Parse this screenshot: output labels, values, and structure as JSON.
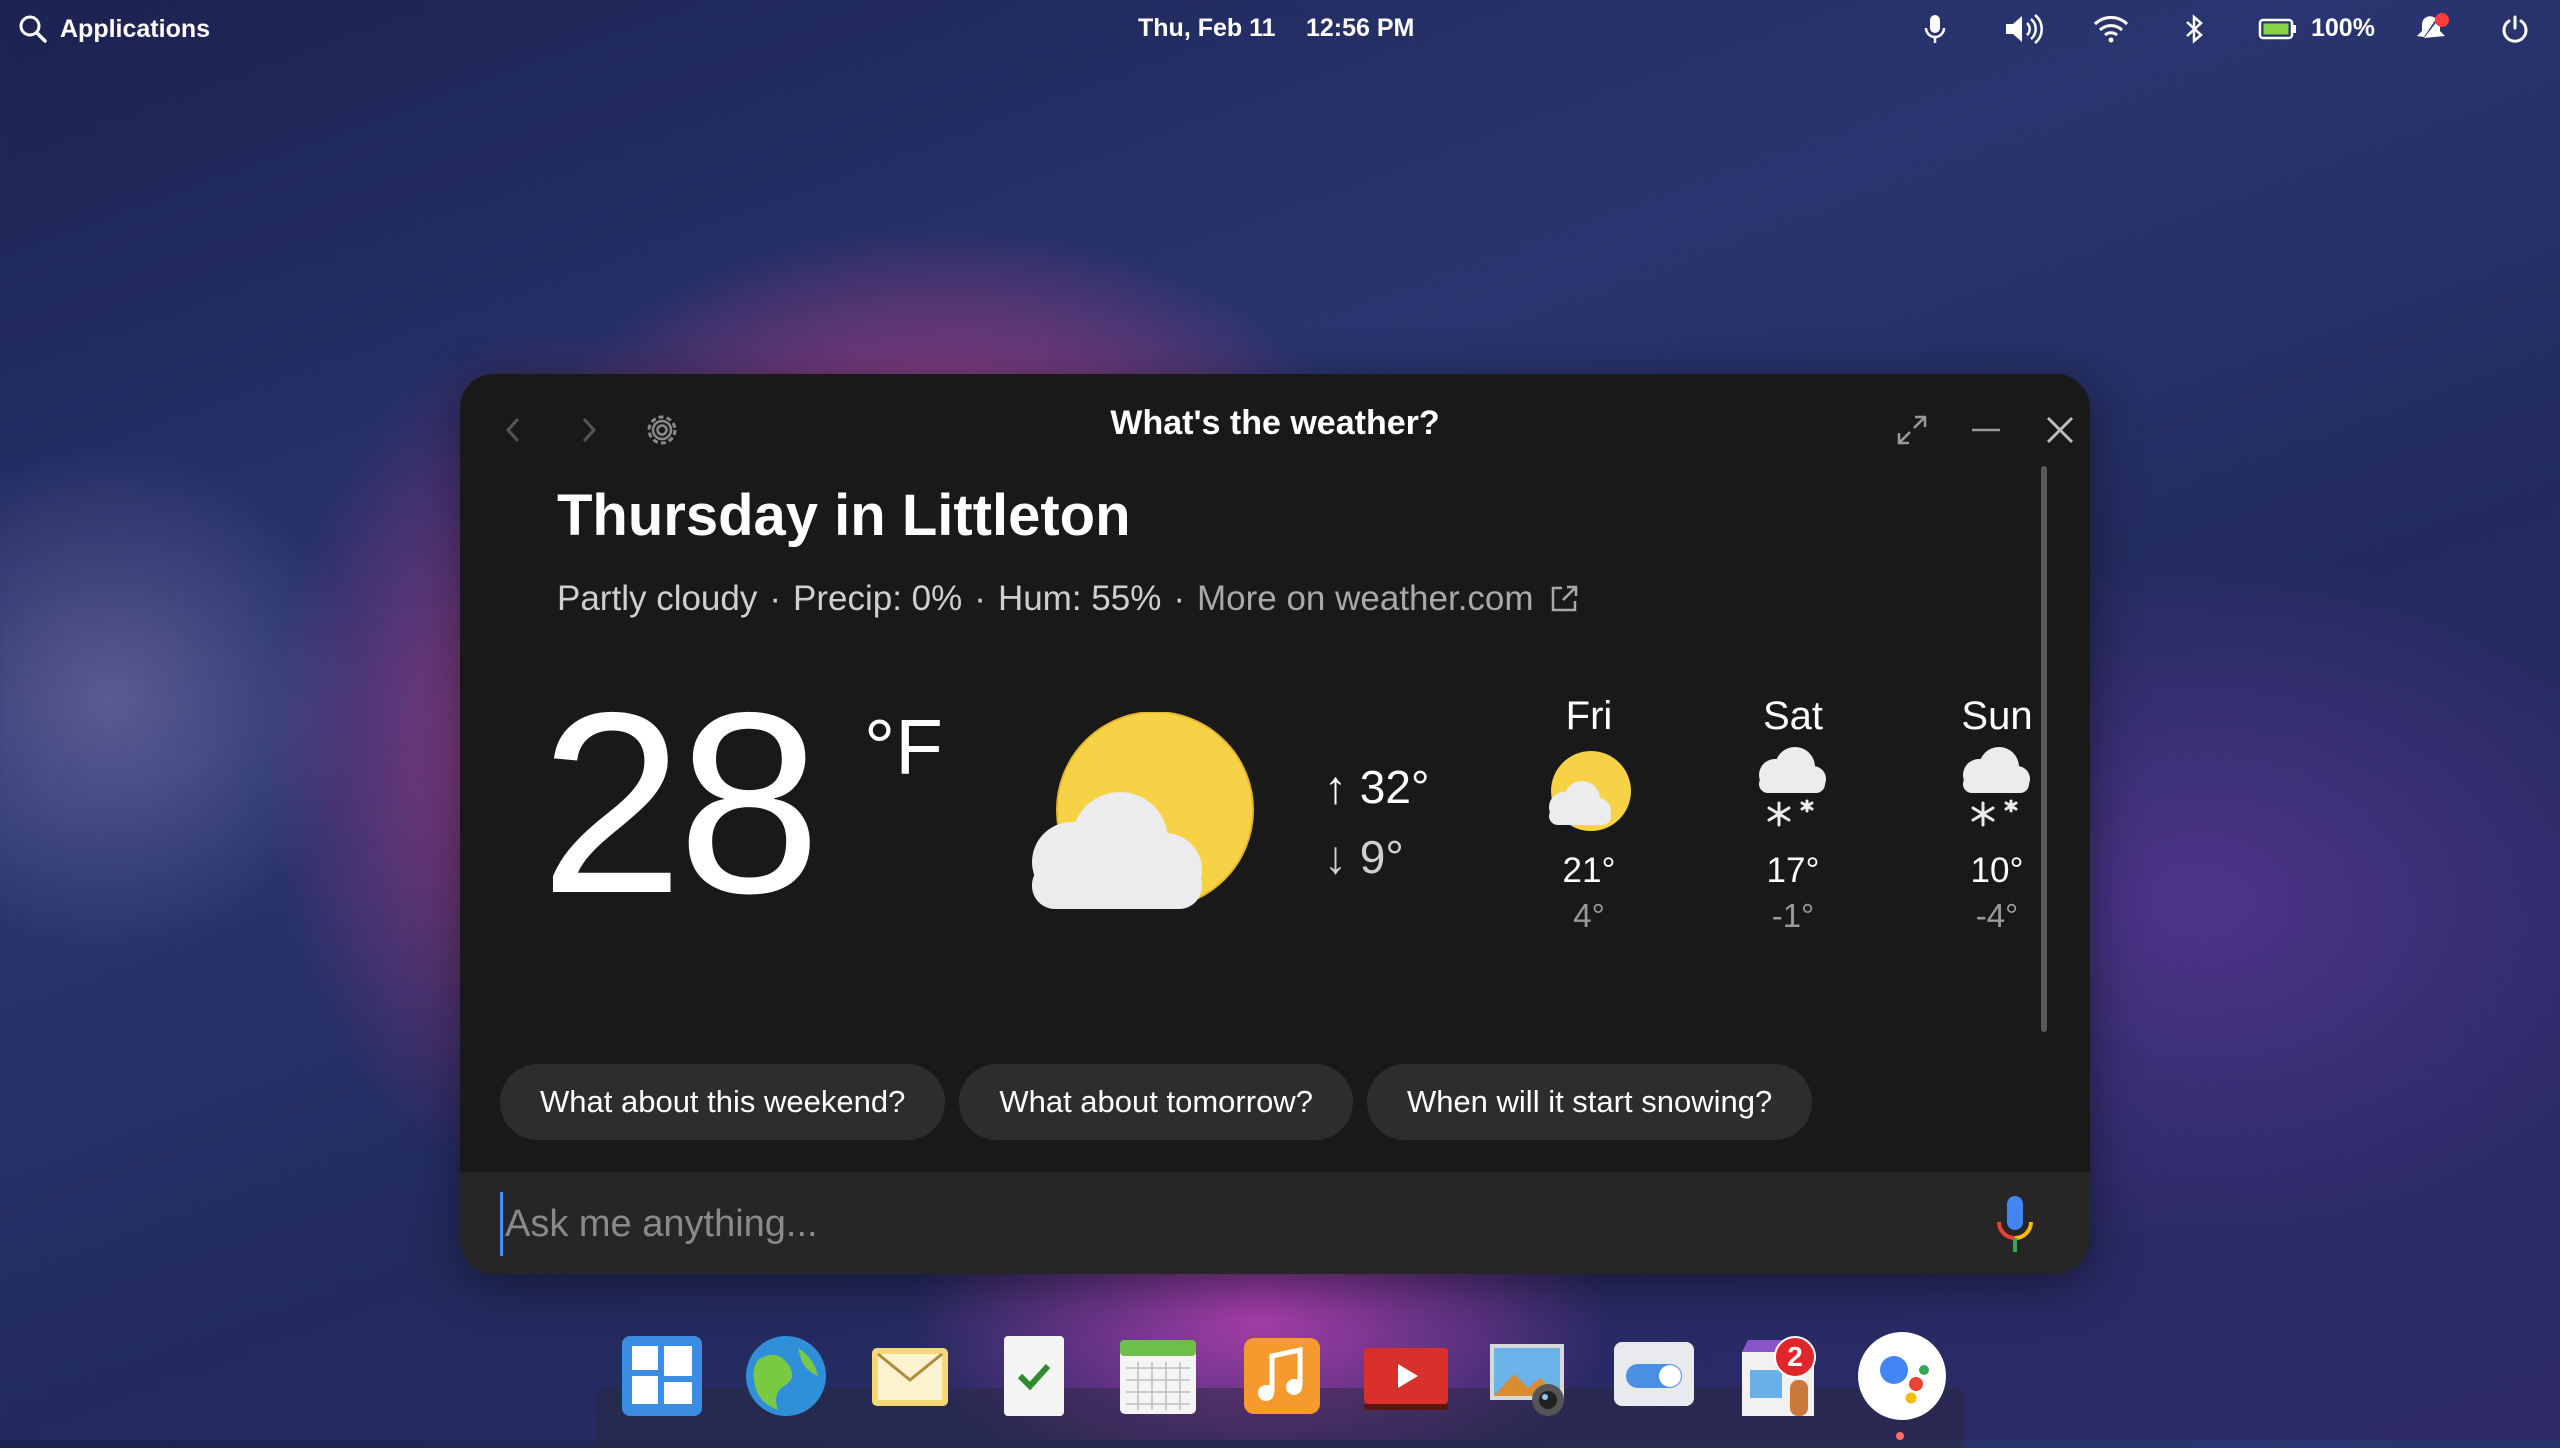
{
  "topbar": {
    "applications_label": "Applications",
    "date": "Thu, Feb 11",
    "time": "12:56 PM",
    "battery_label": "100%"
  },
  "window": {
    "title": "What's the weather?",
    "city_heading": "Thursday in Littleton",
    "condition": "Partly cloudy",
    "sep": "·",
    "precip": "Precip: 0%",
    "humidity": "Hum: 55%",
    "more_link": "More on weather.com",
    "temperature": "28",
    "unit": "°F",
    "high": "↑ 32°",
    "low": "↓ 9°",
    "forecast": [
      {
        "day": "Fri",
        "icon": "partly-cloudy-icon",
        "high": "21°",
        "low": "4°"
      },
      {
        "day": "Sat",
        "icon": "snow-icon",
        "high": "17°",
        "low": "-1°"
      },
      {
        "day": "Sun",
        "icon": "snow-icon",
        "high": "10°",
        "low": "-4°"
      }
    ],
    "suggestions": [
      "What about this weekend?",
      "What about tomorrow?",
      "When will it start snowing?"
    ],
    "input_placeholder": "Ask me anything..."
  },
  "dock": {
    "badge_count": "2",
    "apps": [
      "multitasking-view",
      "web-browser",
      "mail",
      "tasks",
      "calendar",
      "music",
      "videos",
      "photos",
      "system-settings",
      "app-store",
      "assistant"
    ]
  },
  "colors": {
    "window_bg": "#191919",
    "chip_bg": "#2d2d2d",
    "sun_yellow": "#f7d247",
    "assistant_blue": "#4285f4",
    "assistant_red": "#ea4335",
    "assistant_yellow": "#fbbc05",
    "assistant_green": "#34a853"
  }
}
